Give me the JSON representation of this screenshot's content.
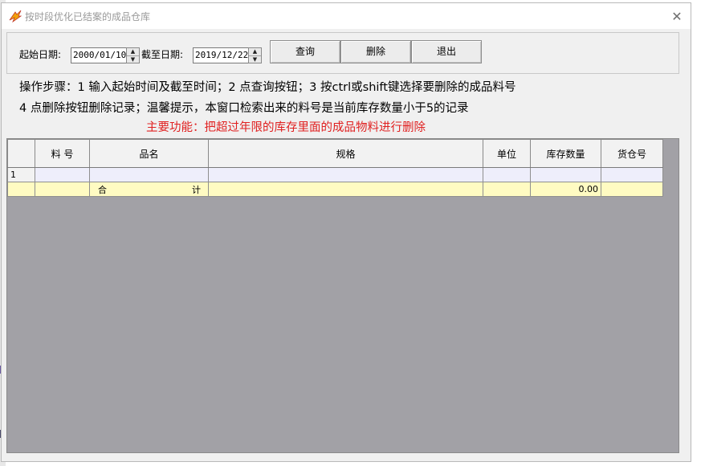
{
  "window": {
    "title": "按时段优化已结案的成品仓库",
    "close_glyph": "✕"
  },
  "query": {
    "start_label": "起始日期:",
    "start_value": "2000/01/10",
    "end_label": "截至日期:",
    "end_value": "2019/12/22",
    "query_button": "查询",
    "delete_button": "删除",
    "exit_button": "退出"
  },
  "instructions": {
    "line1": "操作步骤：1 输入起始时间及截至时间；2 点查询按钮；3 按ctrl或shift键选择要删除的成品料号",
    "line2": "4 点删除按钮删除记录；温馨提示，本窗口检索出来的料号是当前库存数量小于5的记录",
    "main_function": "主要功能：把超过年限的库存里面的成品物料进行删除"
  },
  "grid": {
    "columns": [
      "",
      "料  号",
      "品名",
      "规格",
      "单位",
      "库存数量",
      "货仓号"
    ],
    "rows": [
      {
        "row_header": "1",
        "part_no": "",
        "name": "",
        "spec": "",
        "unit": "",
        "qty": "",
        "warehouse": ""
      }
    ],
    "total_row": {
      "row_header": "",
      "part_no": "",
      "name_left": "合",
      "name_right": "计",
      "spec": "",
      "unit": "",
      "qty": "0.00",
      "warehouse": ""
    }
  },
  "colors": {
    "grid_background": "#a2a1a6",
    "data_row": "#eeeefb",
    "total_row": "#fffbc2",
    "main_function_text": "#e02020"
  }
}
